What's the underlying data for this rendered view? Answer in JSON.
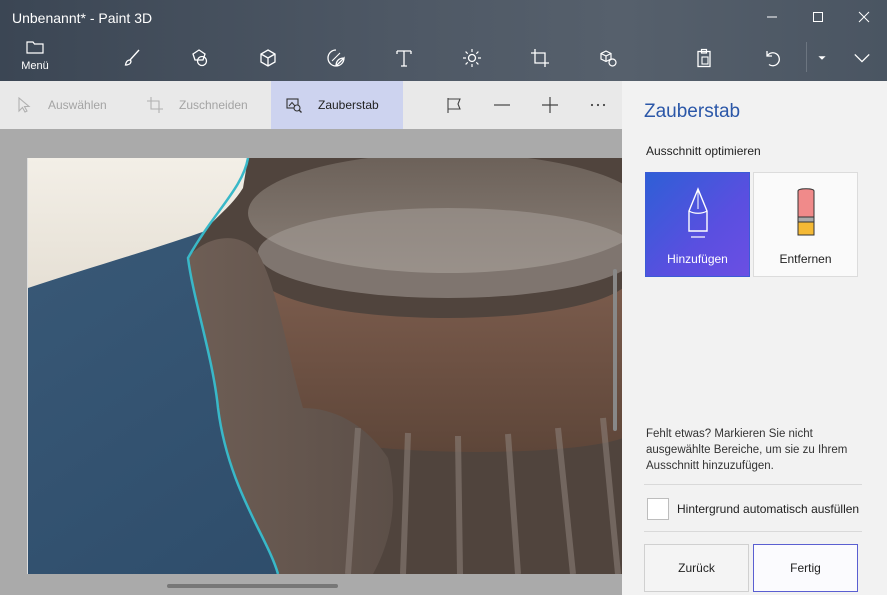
{
  "window": {
    "title": "Unbenannt* - Paint 3D"
  },
  "toolbar": {
    "menu_label": "Menü",
    "tools": [
      {
        "name": "brushes",
        "icon": "brush-icon"
      },
      {
        "name": "2d-shapes",
        "icon": "2d-shapes-icon"
      },
      {
        "name": "3d-shapes",
        "icon": "cube-icon"
      },
      {
        "name": "stickers",
        "icon": "sticker-icon"
      },
      {
        "name": "text",
        "icon": "text-icon"
      },
      {
        "name": "effects",
        "icon": "sun-icon"
      },
      {
        "name": "canvas",
        "icon": "canvas-icon"
      },
      {
        "name": "3d-library",
        "icon": "3d-library-icon"
      }
    ]
  },
  "subbar": {
    "select_label": "Auswählen",
    "crop_label": "Zuschneiden",
    "magic_select_label": "Zauberstab"
  },
  "panel": {
    "title": "Zauberstab",
    "subtitle": "Ausschnitt optimieren",
    "add_label": "Hinzufügen",
    "remove_label": "Entfernen",
    "hint": "Fehlt etwas? Markieren Sie nicht ausgewählte Bereiche, um sie zu Ihrem Ausschnitt hinzuzufügen.",
    "autofill_label": "Hintergrund automatisch ausfüllen",
    "autofill_checked": false,
    "back_label": "Zurück",
    "done_label": "Fertig"
  },
  "colors": {
    "accent_blue": "#2b57a8",
    "active_tab": "#cdd3ef",
    "selection_outline": "#39b8c8"
  }
}
